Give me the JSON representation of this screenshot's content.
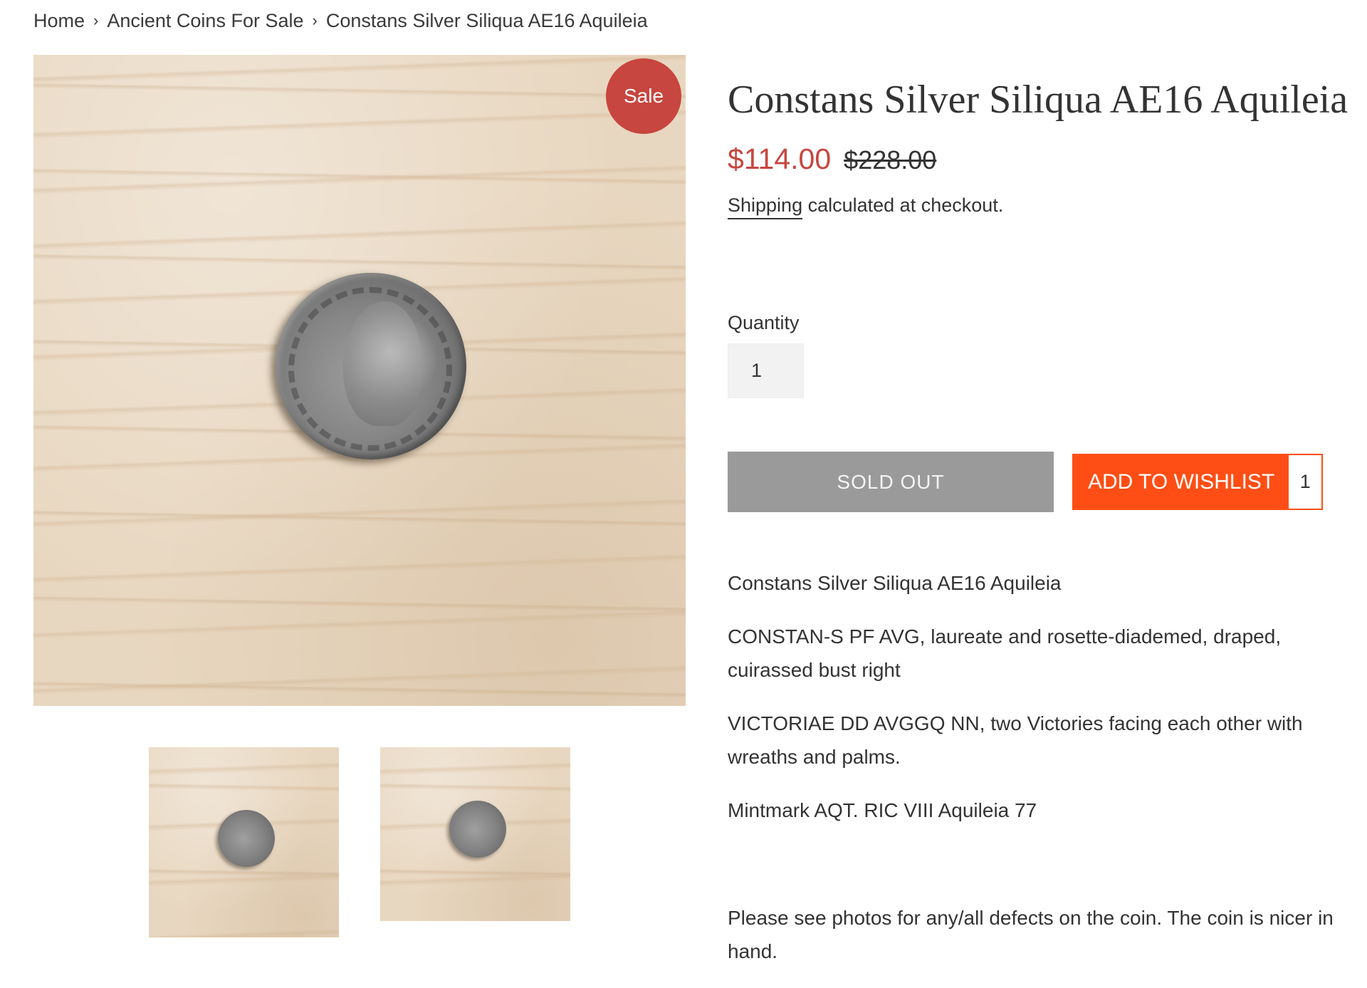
{
  "breadcrumb": {
    "home": "Home",
    "separator": "›",
    "collection": "Ancient Coins For Sale",
    "current": "Constans Silver Siliqua AE16 Aquileia"
  },
  "gallery": {
    "sale_badge": "Sale",
    "main_image_alt": "Constans Silver Siliqua AE16 Aquileia",
    "thumbnail_count": 2
  },
  "product": {
    "title": "Constans Silver Siliqua AE16 Aquileia",
    "price": "$114.00",
    "compare_at_price": "$228.00",
    "shipping_link": "Shipping",
    "shipping_text": " calculated at checkout.",
    "quantity_label": "Quantity",
    "quantity_value": "1",
    "sold_out_label": "Sold Out",
    "wishlist_label": "ADD TO WISHLIST",
    "wishlist_count": "1",
    "description": [
      "Constans Silver Siliqua AE16 Aquileia",
      "CONSTAN-S PF AVG, laureate and rosette-diademed, draped, cuirassed bust right",
      "VICTORIAE DD AVGGQ NN, two Victories facing each other with wreaths and palms.",
      "Mintmark AQT. RIC VIII Aquileia 77",
      "Please see photos for any/all defects on the coin. The coin is nicer in hand."
    ]
  },
  "colors": {
    "sale_red": "#c7463f",
    "wishlist_orange": "#ff4e15",
    "sold_out_gray": "#9a9a9a",
    "text": "#333333"
  }
}
